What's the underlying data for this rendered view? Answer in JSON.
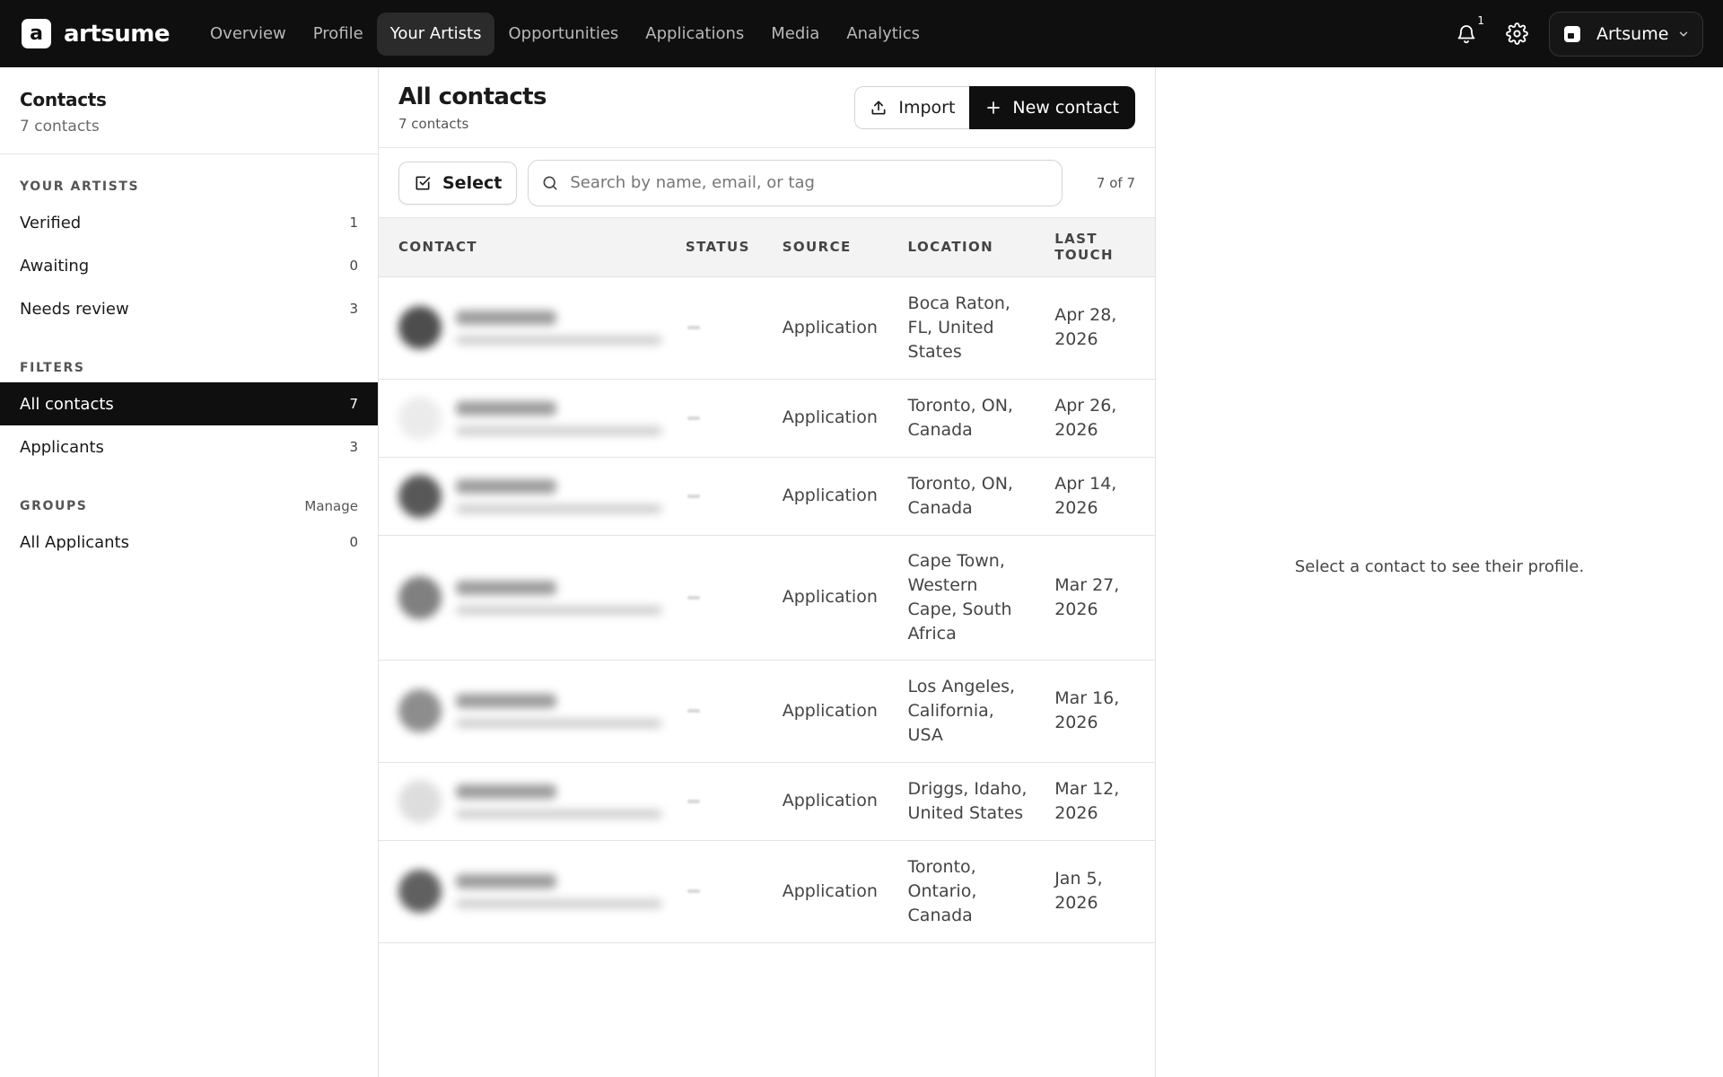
{
  "brand": {
    "name": "artsume",
    "logo_letter": "a"
  },
  "nav": {
    "items": [
      {
        "label": "Overview",
        "active": false
      },
      {
        "label": "Profile",
        "active": false
      },
      {
        "label": "Your Artists",
        "active": true
      },
      {
        "label": "Opportunities",
        "active": false
      },
      {
        "label": "Applications",
        "active": false
      },
      {
        "label": "Media",
        "active": false
      },
      {
        "label": "Analytics",
        "active": false
      }
    ]
  },
  "header_right": {
    "notification_count": "1",
    "account_name": "Artsume",
    "icons": [
      "bell-icon",
      "gear-icon",
      "chevron-down-icon"
    ]
  },
  "sidebar": {
    "title": "Contacts",
    "subtitle": "7 contacts",
    "artists_section": {
      "title": "YOUR ARTISTS",
      "items": [
        {
          "label": "Verified",
          "count": "1"
        },
        {
          "label": "Awaiting",
          "count": "0"
        },
        {
          "label": "Needs review",
          "count": "3"
        }
      ]
    },
    "filters_section": {
      "title": "FILTERS",
      "items": [
        {
          "label": "All contacts",
          "count": "7",
          "active": true
        },
        {
          "label": "Applicants",
          "count": "3",
          "active": false
        }
      ]
    },
    "groups_section": {
      "title": "GROUPS",
      "manage_label": "Manage",
      "items": [
        {
          "label": "All Applicants",
          "count": "0"
        }
      ]
    }
  },
  "list": {
    "title": "All contacts",
    "subtitle": "7 contacts",
    "import_label": "Import",
    "new_contact_label": "New contact",
    "select_label": "Select",
    "search_placeholder": "Search by name, email, or tag",
    "count_label": "7 of 7",
    "columns": {
      "contact": "CONTACT",
      "status": "STATUS",
      "source": "SOURCE",
      "location": "LOCATION",
      "last_touch_1": "LAST",
      "last_touch_2": "TOUCH"
    },
    "rows": [
      {
        "source": "Application",
        "location": [
          "Boca Raton,",
          "FL, United",
          "States"
        ],
        "last_touch": [
          "Apr 28,",
          "2026"
        ]
      },
      {
        "source": "Application",
        "location": [
          "Toronto, ON,",
          "Canada"
        ],
        "last_touch": [
          "Apr 26,",
          "2026"
        ]
      },
      {
        "source": "Application",
        "location": [
          "Toronto, ON,",
          "Canada"
        ],
        "last_touch": [
          "Apr 14,",
          "2026"
        ]
      },
      {
        "source": "Application",
        "location": [
          "Cape Town,",
          "Western",
          "Cape, South",
          "Africa"
        ],
        "last_touch": [
          "Mar 27,",
          "2026"
        ]
      },
      {
        "source": "Application",
        "location": [
          "Los Angeles,",
          "California,",
          "USA"
        ],
        "last_touch": [
          "Mar 16,",
          "2026"
        ]
      },
      {
        "source": "Application",
        "location": [
          "Driggs, Idaho,",
          "United States"
        ],
        "last_touch": [
          "Mar 12,",
          "2026"
        ]
      },
      {
        "source": "Application",
        "location": [
          "Toronto,",
          "Ontario,",
          "Canada"
        ],
        "last_touch": [
          "Jan 5,",
          "2026"
        ]
      }
    ]
  },
  "detail": {
    "empty_message": "Select a contact to see their profile."
  }
}
